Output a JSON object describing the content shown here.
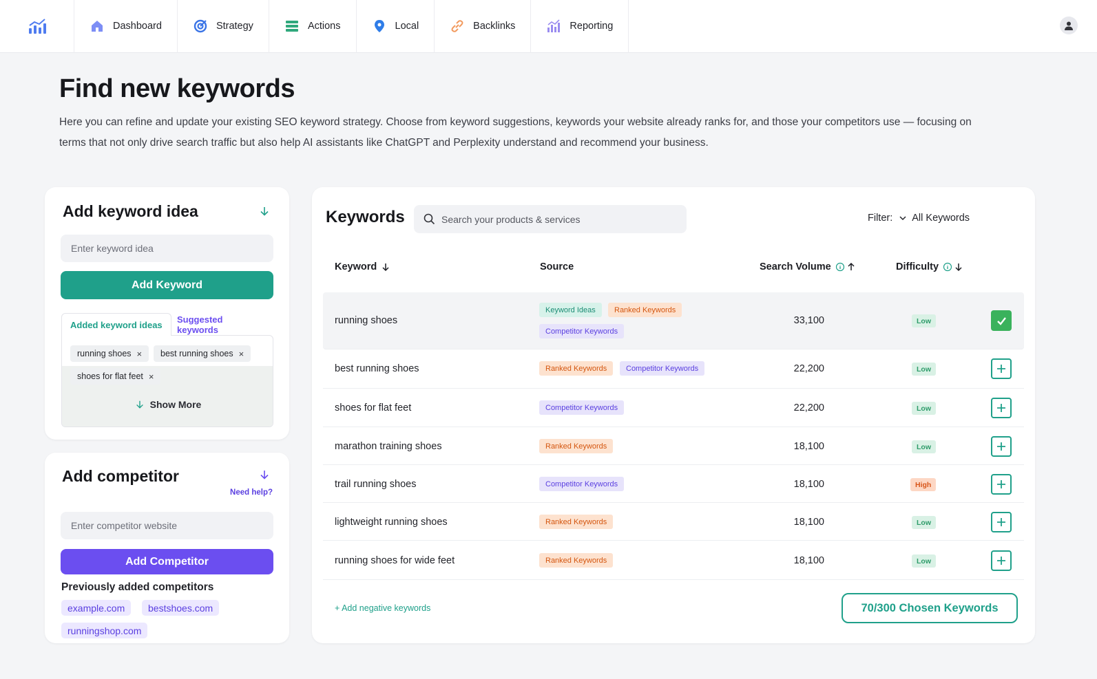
{
  "nav": {
    "logo": "chart-logo",
    "items": [
      {
        "label": "Dashboard",
        "icon": "home-icon"
      },
      {
        "label": "Strategy",
        "icon": "strategy-icon"
      },
      {
        "label": "Actions",
        "icon": "actions-icon"
      },
      {
        "label": "Local",
        "icon": "location-pin-icon"
      },
      {
        "label": "Backlinks",
        "icon": "link-icon"
      },
      {
        "label": "Reporting",
        "icon": "bar-chart-icon"
      }
    ],
    "user_icon": "user-icon"
  },
  "header": {
    "title": "Find new keywords",
    "description": "Here you can refine and update your existing SEO keyword strategy. Choose from keyword suggestions, keywords your website already ranks for, and those your competitors use — focusing on terms that not only drive search traffic but also help AI assistants like ChatGPT and Perplexity understand and recommend your business."
  },
  "keyword_idea": {
    "title": "Add keyword idea",
    "input_placeholder": "Enter keyword idea",
    "button": "Add Keyword",
    "tabs": [
      "Added keyword ideas",
      "Suggested keywords"
    ],
    "chips": [
      "running shoes",
      "best running shoes",
      "shoes for flat feet"
    ],
    "chip_remove": "×",
    "show_more": "Show More"
  },
  "competitor": {
    "title": "Add competitor",
    "need_help": "Need help?",
    "input_placeholder": "Enter competitor website",
    "button": "Add Competitor",
    "previous_title": "Previously added competitors",
    "previous": [
      "example.com",
      "bestshoes.com",
      "runningshop.com"
    ]
  },
  "keywords": {
    "title": "Keywords",
    "search_placeholder": "Search your products & services",
    "filter_label": "Filter:",
    "filter_value": "All Keywords",
    "columns": {
      "keyword": "Keyword",
      "source": "Source",
      "volume": "Search Volume",
      "difficulty": "Difficulty"
    },
    "rows": [
      {
        "keyword": "running shoes",
        "sources": [
          "Keyword Ideas",
          "Ranked Keywords",
          "Competitor Keywords"
        ],
        "volume": "33,100",
        "difficulty": "Low",
        "selected": true
      },
      {
        "keyword": "best running shoes",
        "sources": [
          "Ranked Keywords",
          "Competitor Keywords"
        ],
        "volume": "22,200",
        "difficulty": "Low",
        "selected": false
      },
      {
        "keyword": "shoes for flat feet",
        "sources": [
          "Competitor Keywords"
        ],
        "volume": "22,200",
        "difficulty": "Low",
        "selected": false
      },
      {
        "keyword": "marathon training shoes",
        "sources": [
          "Ranked Keywords"
        ],
        "volume": "18,100",
        "difficulty": "Low",
        "selected": false
      },
      {
        "keyword": "trail running shoes",
        "sources": [
          "Competitor Keywords"
        ],
        "volume": "18,100",
        "difficulty": "High",
        "selected": false
      },
      {
        "keyword": "lightweight running shoes",
        "sources": [
          "Ranked Keywords"
        ],
        "volume": "18,100",
        "difficulty": "Low",
        "selected": false
      },
      {
        "keyword": "running shoes for wide feet",
        "sources": [
          "Ranked Keywords"
        ],
        "volume": "18,100",
        "difficulty": "Low",
        "selected": false
      }
    ],
    "add_negative": "+ Add negative keywords",
    "chosen": "70/300 Chosen Keywords"
  },
  "colors": {
    "accent_green": "#1fa08a",
    "accent_purple": "#6b4ef0",
    "check_green": "#3ab25c"
  }
}
